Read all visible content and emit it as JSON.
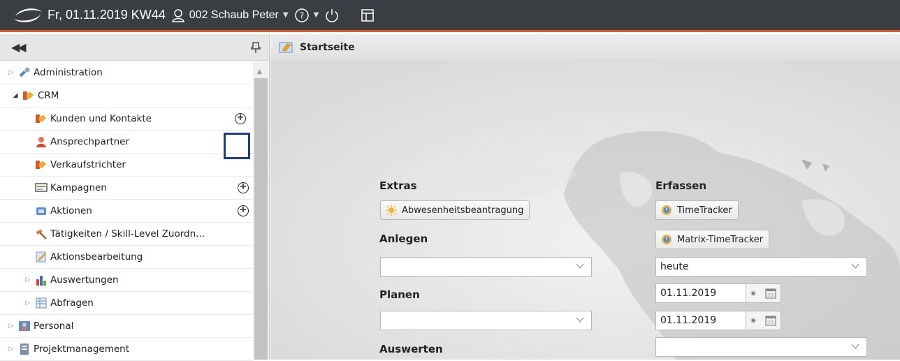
{
  "topbar": {
    "date": "Fr, 01.11.2019 KW44",
    "user": "002 Schaub Peter"
  },
  "sidebar": {
    "items": [
      {
        "label": "Administration"
      },
      {
        "label": "CRM"
      },
      {
        "label": "Kunden und Kontakte"
      },
      {
        "label": "Ansprechpartner"
      },
      {
        "label": "Verkaufstrichter"
      },
      {
        "label": "Kampagnen"
      },
      {
        "label": "Aktionen"
      },
      {
        "label": "Tätigkeiten / Skill-Level Zuordn..."
      },
      {
        "label": "Aktionsbearbeitung"
      },
      {
        "label": "Auswertungen"
      },
      {
        "label": "Abfragen"
      },
      {
        "label": "Personal"
      },
      {
        "label": "Projektmanagement"
      }
    ]
  },
  "main": {
    "title": "Startseite",
    "extras": {
      "heading": "Extras",
      "button": "Abwesenheitsbeantragung"
    },
    "anlegen": {
      "heading": "Anlegen",
      "value": ""
    },
    "planen": {
      "heading": "Planen",
      "value": ""
    },
    "auswerten": {
      "heading": "Auswerten"
    },
    "erfassen": {
      "heading": "Erfassen",
      "timetracker": "TimeTracker",
      "matrix": "Matrix-TimeTracker",
      "period": "heute",
      "date_from": "01.11.2019",
      "date_to": "01.11.2019",
      "bottom_value": ""
    }
  },
  "colors": {
    "accent": "#d9582b",
    "topbar": "#3a3d42",
    "highlight": "#1b3e8c"
  }
}
